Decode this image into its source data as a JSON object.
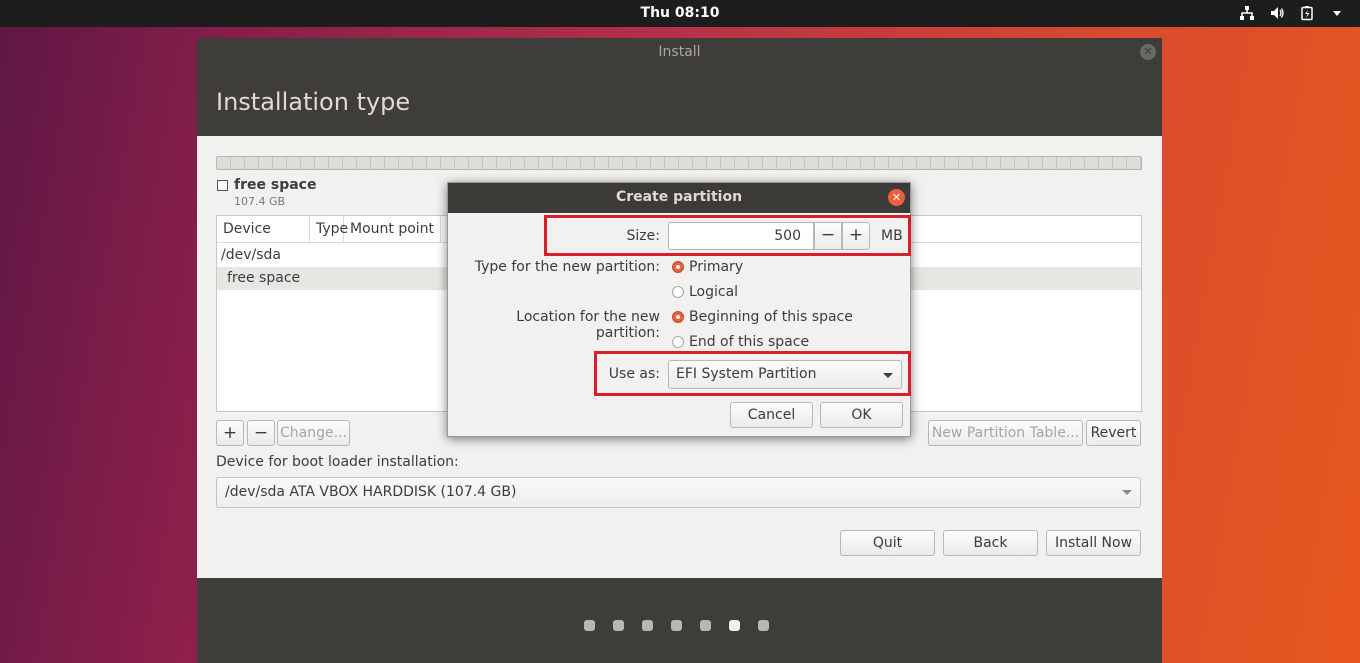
{
  "topbar": {
    "clock": "Thu 08:10",
    "tray_icons": [
      "network-icon",
      "volume-icon",
      "battery-icon",
      "system-menu-arrow-icon"
    ]
  },
  "window": {
    "title": "Install",
    "page_title": "Installation type",
    "legend": {
      "label": "free space",
      "size": "107.4 GB"
    },
    "table": {
      "columns": [
        "Device",
        "Type",
        "Mount point"
      ],
      "rows": [
        "/dev/sda",
        "free space"
      ]
    },
    "buttons": {
      "add": "+",
      "remove": "−",
      "change": "Change...",
      "new_partition_table": "New Partition Table...",
      "revert": "Revert",
      "quit": "Quit",
      "back": "Back",
      "install_now": "Install Now"
    },
    "boot_loader": {
      "label": "Device for boot loader installation:",
      "value": "/dev/sda ATA VBOX HARDDISK (107.4 GB)"
    },
    "steps": {
      "total": 7,
      "active": 6
    }
  },
  "dialog": {
    "title": "Create partition",
    "size_label": "Size:",
    "size_value": "500",
    "size_unit": "MB",
    "decrement": "−",
    "increment": "+",
    "type_label": "Type for the new partition:",
    "type_options": [
      "Primary",
      "Logical"
    ],
    "type_selected": "Primary",
    "location_label": "Location for the new partition:",
    "location_options": [
      "Beginning of this space",
      "End of this space"
    ],
    "location_selected": "Beginning of this space",
    "use_as_label": "Use as:",
    "use_as_value": "EFI System Partition",
    "cancel": "Cancel",
    "ok": "OK"
  },
  "colors": {
    "accent": "#e9603e",
    "highlight": "#d9202a",
    "titlebar": "#3f3d3a"
  }
}
